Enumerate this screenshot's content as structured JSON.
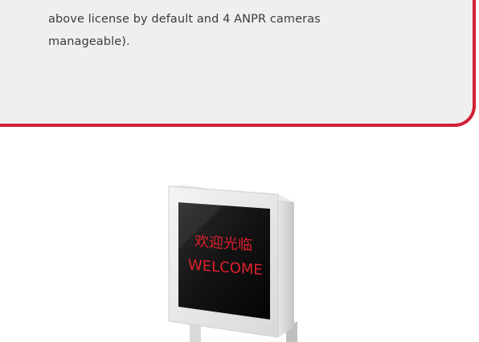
{
  "info_card": {
    "lines": [
      "above license by default and 4 ANPR cameras",
      "manageable)."
    ]
  },
  "display_sign": {
    "line1": "欢迎光临",
    "line2": "WELCOME",
    "text_color": "#e0202c"
  },
  "colors": {
    "accent": "#d21f35",
    "card_background": "#efefef",
    "text": "#3b3b3b"
  }
}
